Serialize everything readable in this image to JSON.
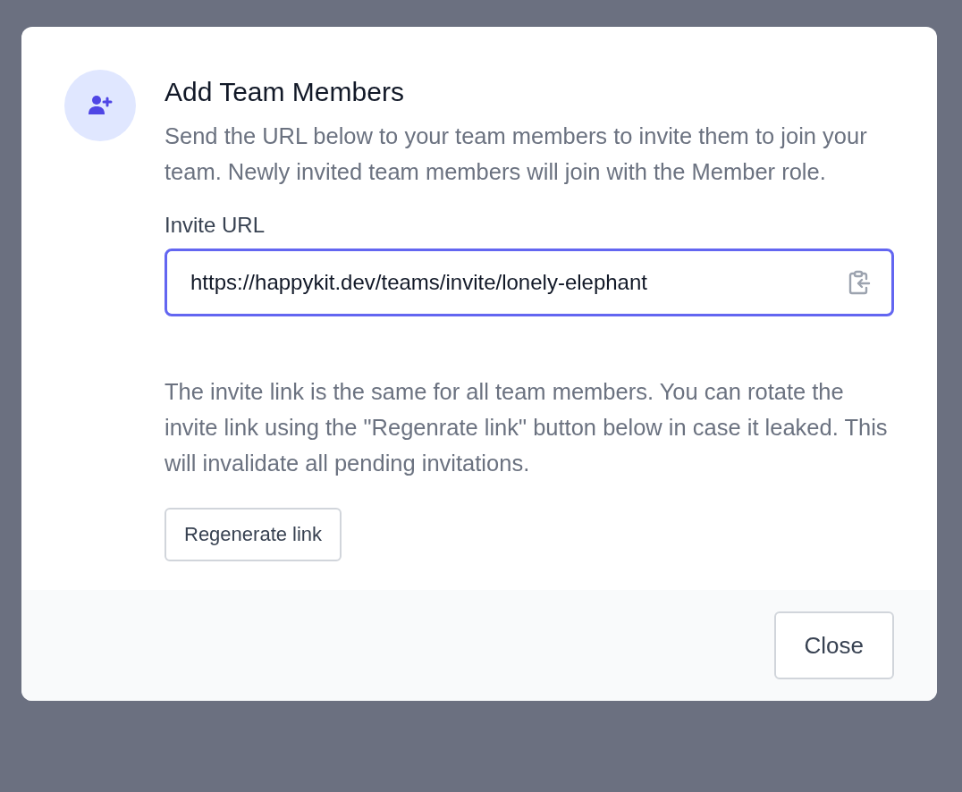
{
  "dialog": {
    "title": "Add Team Members",
    "description": "Send the URL below to your team members to invite them to join your team. Newly invited team members will join with the Member role.",
    "invite_field": {
      "label": "Invite URL",
      "value": "https://happykit.dev/teams/invite/lonely-elephant",
      "focused": true
    },
    "note": "The invite link is the same for all team members. You can rotate the invite link using the \"Regenrate link\" button below in case it leaked. This will invalidate all pending invitations.",
    "regenerate_button": "Regenerate link",
    "close_button": "Close"
  }
}
